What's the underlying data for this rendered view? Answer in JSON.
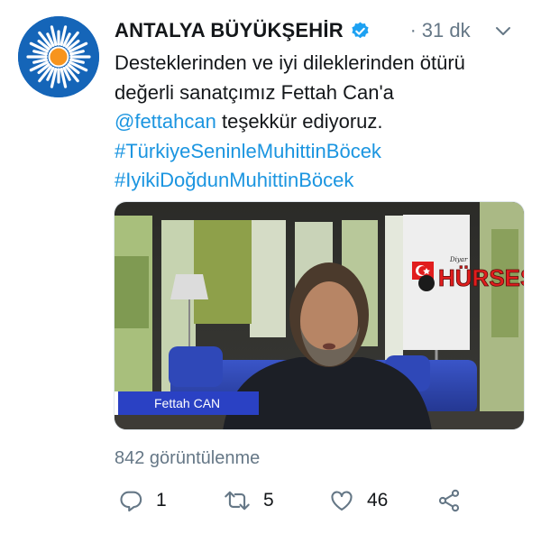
{
  "tweet": {
    "author_name": "ANTALYA BÜYÜKŞEHİR",
    "time_separator": "·",
    "time": "31 dk",
    "text_lines": [
      "Desteklerinden ve iyi dileklerinden ötürü",
      "değerli sanatçımız Fettah Can'a"
    ],
    "mention": "@fettahcan",
    "text_after_mention": " teşekkür ediyoruz.",
    "hashtag_1": "#TürkiyeSeninleMuhittinBöcek",
    "hashtag_2": "#IyikiDoğdunMuhittinBöcek",
    "link_color": "#1b95e0",
    "verified_color": "#1da1f2"
  },
  "media": {
    "lower_third_name": "Fettah CAN",
    "watermark": {
      "text": "HÜRSES",
      "small_text": "Diyar"
    }
  },
  "stats": {
    "views_label": "842 görüntülenme"
  },
  "actions": {
    "reply_count": "1",
    "retweet_count": "5",
    "like_count": "46"
  }
}
